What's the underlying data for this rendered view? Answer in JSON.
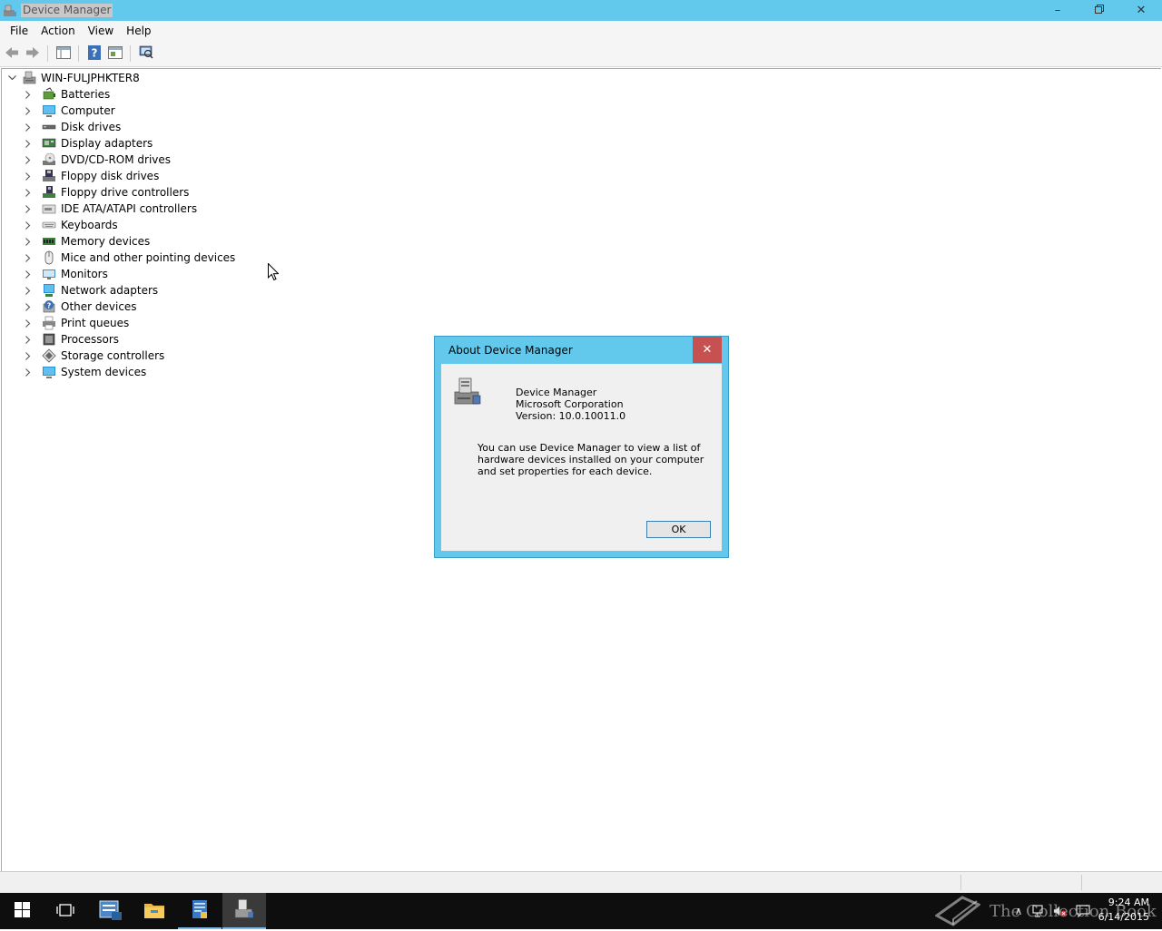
{
  "window": {
    "title": "Device Manager",
    "controls": [
      "minimize-icon",
      "restore-icon",
      "close-icon"
    ]
  },
  "menu": {
    "items": [
      {
        "label": "File"
      },
      {
        "label": "Action"
      },
      {
        "label": "View"
      },
      {
        "label": "Help"
      }
    ]
  },
  "toolbar": {
    "icons": [
      "back-arrow-icon",
      "forward-arrow-icon",
      "console-tree-icon",
      "help-icon",
      "properties-icon",
      "scan-hardware-icon"
    ]
  },
  "tree": {
    "root": {
      "label": "WIN-FULJPHKTER8",
      "icon": "computer-root-icon",
      "expanded": true
    },
    "children": [
      {
        "label": "Batteries",
        "icon": "battery-icon"
      },
      {
        "label": "Computer",
        "icon": "computer-icon"
      },
      {
        "label": "Disk drives",
        "icon": "disk-drive-icon"
      },
      {
        "label": "Display adapters",
        "icon": "display-adapter-icon"
      },
      {
        "label": "DVD/CD-ROM drives",
        "icon": "dvd-drive-icon"
      },
      {
        "label": "Floppy disk drives",
        "icon": "floppy-disk-icon"
      },
      {
        "label": "Floppy drive controllers",
        "icon": "floppy-controller-icon"
      },
      {
        "label": "IDE ATA/ATAPI controllers",
        "icon": "ide-controller-icon"
      },
      {
        "label": "Keyboards",
        "icon": "keyboard-icon"
      },
      {
        "label": "Memory devices",
        "icon": "memory-icon"
      },
      {
        "label": "Mice and other pointing devices",
        "icon": "mouse-icon"
      },
      {
        "label": "Monitors",
        "icon": "monitor-icon"
      },
      {
        "label": "Network adapters",
        "icon": "network-adapter-icon"
      },
      {
        "label": "Other devices",
        "icon": "other-devices-icon"
      },
      {
        "label": "Print queues",
        "icon": "printer-icon"
      },
      {
        "label": "Processors",
        "icon": "processor-icon"
      },
      {
        "label": "Storage controllers",
        "icon": "storage-controller-icon"
      },
      {
        "label": "System devices",
        "icon": "system-devices-icon"
      }
    ]
  },
  "dialog": {
    "title": "About Device Manager",
    "product": "Device Manager",
    "company": "Microsoft Corporation",
    "version": "Version: 10.0.10011.0",
    "description": "You can use Device Manager to view a list of hardware devices installed on your computer and set properties for each device.",
    "ok_label": "OK"
  },
  "taskbar": {
    "buttons": [
      "start-icon",
      "task-view-icon",
      "server-manager-icon",
      "file-explorer-icon",
      "tools-icon",
      "device-manager-icon"
    ],
    "watermark": "The Collection Book",
    "time": "9:24 AM",
    "date": "6/14/2015"
  },
  "colors": {
    "titlebar": "#62c9ec",
    "dialog_close": "#c75050",
    "taskbar": "#0e0e0e"
  }
}
